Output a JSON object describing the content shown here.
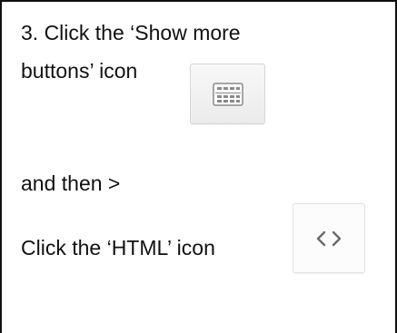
{
  "instructions": {
    "line1": "3. Click the ‘Show more",
    "line2": "buttons’ icon",
    "line3": "and then >",
    "line4": "Click the ‘HTML’ icon"
  },
  "icons": {
    "show_more": "keyboard-icon",
    "html": "code-brackets-icon"
  },
  "colors": {
    "border": "#111111",
    "button_bg": "#f3f3f3",
    "icon_stroke": "#8a8a8a"
  }
}
